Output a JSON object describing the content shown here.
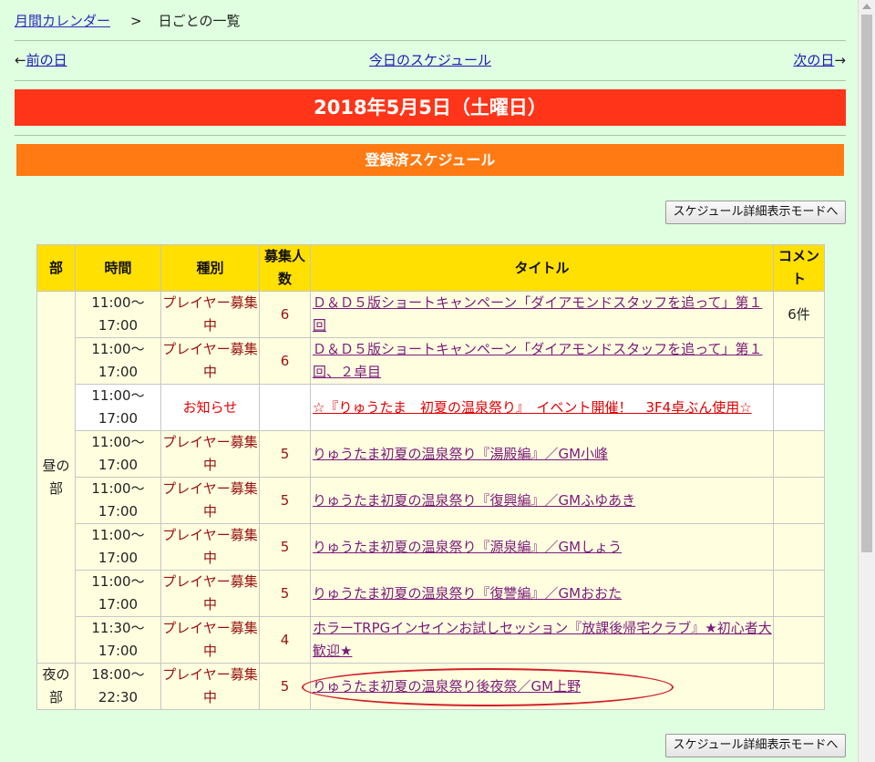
{
  "breadcrumb": {
    "home": "月間カレンダー",
    "separator": ">",
    "current": "日ごとの一覧"
  },
  "nav": {
    "prev_arrow": "←",
    "prev": "前の日",
    "today": "今日のスケジュール",
    "next": "次の日",
    "next_arrow": "→"
  },
  "date_title": "2018年5月5日（土曜日）",
  "section_title": "登録済スケジュール",
  "mode_button": "スケジュール詳細表示モードへ",
  "table": {
    "headers": {
      "part": "部",
      "time": "時間",
      "kind": "種別",
      "count": "募集人数",
      "title": "タイトル",
      "comment": "コメント"
    },
    "parts": {
      "day": "昼の部",
      "night": "夜の部"
    },
    "rows": [
      {
        "time": "11:00〜17:00",
        "kind": "プレイヤー募集中",
        "count": "6",
        "title": "Ｄ＆Ｄ５版ショートキャンペーン「ダイアモンドスタッフを追って」第１回",
        "comment": "6件"
      },
      {
        "time": "11:00〜17:00",
        "kind": "プレイヤー募集中",
        "count": "6",
        "title": "Ｄ＆Ｄ５版ショートキャンペーン「ダイアモンドスタッフを追って」第１回、２卓目",
        "comment": ""
      },
      {
        "time": "11:00〜17:00",
        "kind": "お知らせ",
        "count": "",
        "title": "☆『りゅうたま　初夏の温泉祭り』　イベント開催！　3F4卓ぶん使用☆",
        "comment": ""
      },
      {
        "time": "11:00〜17:00",
        "kind": "プレイヤー募集中",
        "count": "5",
        "title": "りゅうたま初夏の温泉祭り『湯殿編』／GM小峰",
        "comment": ""
      },
      {
        "time": "11:00〜17:00",
        "kind": "プレイヤー募集中",
        "count": "5",
        "title": "りゅうたま初夏の温泉祭り『復興編』／GMふゆあき",
        "comment": ""
      },
      {
        "time": "11:00〜17:00",
        "kind": "プレイヤー募集中",
        "count": "5",
        "title": "りゅうたま初夏の温泉祭り『源泉編』／GMしょう",
        "comment": ""
      },
      {
        "time": "11:00〜17:00",
        "kind": "プレイヤー募集中",
        "count": "5",
        "title": "りゅうたま初夏の温泉祭り『復讐編』／GMおおた",
        "comment": ""
      },
      {
        "time": "11:30〜17:00",
        "kind": "プレイヤー募集中",
        "count": "4",
        "title": "ホラーTRPGインセインお試しセッション『放課後帰宅クラブ』★初心者大歓迎★",
        "comment": ""
      },
      {
        "time": "18:00〜22:30",
        "kind": "プレイヤー募集中",
        "count": "5",
        "title": "りゅうたま初夏の温泉祭り後夜祭／GM上野",
        "comment": ""
      }
    ]
  },
  "colors": {
    "page_bg": "#e0ffe0",
    "date_bar": "#ff3418",
    "section_bar": "#ff7a12",
    "header_bg": "#ffe000",
    "highlight_oval": "#d4202a"
  }
}
